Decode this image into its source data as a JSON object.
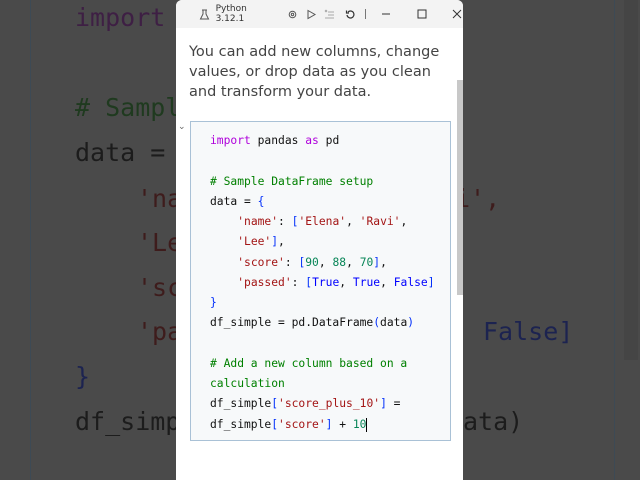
{
  "background": {
    "left": [
      "import",
      "# Sampl",
      "data =",
      "'na",
      "'Le",
      "'sc",
      "'pa",
      "}",
      "df_simp"
    ],
    "right": [
      "i',",
      "False]",
      "ata)"
    ]
  },
  "titlebar": {
    "kernel": "Python 3.12.1"
  },
  "description": "You can add new columns, change values, or drop data as you clean and transform your data.",
  "code": {
    "l1": {
      "kw": "import",
      "a": " pandas ",
      "kw2": "as",
      "b": " pd"
    },
    "l2": "# Sample DataFrame setup",
    "l3": {
      "a": "data = ",
      "b": "{"
    },
    "l4": {
      "k": "'name'",
      "a": ": ",
      "ob": "[",
      "s1": "'Elena'",
      "c1": ", ",
      "s2": "'Ravi'",
      "c2": ","
    },
    "l5": {
      "s": "'Lee'",
      "cb": "]",
      "c": ","
    },
    "l6": {
      "k": "'score'",
      "a": ": ",
      "ob": "[",
      "n1": "90",
      "c1": ", ",
      "n2": "88",
      "c2": ", ",
      "n3": "70",
      "cb": "]",
      "c": ","
    },
    "l7": {
      "k": "'passed'",
      "a": ": ",
      "ob": "[",
      "t1": "True",
      "c1": ", ",
      "t2": "True",
      "c2": ", ",
      "t3": "False",
      "cb": "]"
    },
    "l8": "}",
    "l9": {
      "a": "df_simple = pd.DataFrame",
      "ob": "(",
      "b": "data",
      "cb": ")"
    },
    "l10": "# Add a new column based on a",
    "l11": "calculation",
    "l12": {
      "a": "df_simple",
      "ob": "[",
      "s": "'score_plus_10'",
      "cb": "]",
      "b": " ="
    },
    "l13": {
      "a": "df_simple",
      "ob": "[",
      "s": "'score'",
      "cb": "]",
      "b": " + ",
      "n": "10"
    }
  }
}
